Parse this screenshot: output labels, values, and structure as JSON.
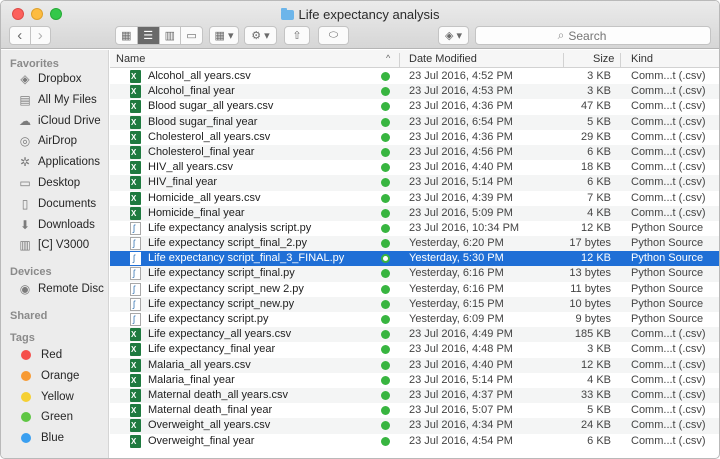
{
  "window": {
    "title": "Life expectancy analysis",
    "search_placeholder": "Search"
  },
  "toolbar": {
    "back_glyph": "‹",
    "forward_glyph": "›",
    "view_icon_glyph": "▦",
    "view_list_glyph": "☰",
    "view_column_glyph": "▥",
    "view_coverflow_glyph": "▭",
    "arrange_glyph": "▦ ▾",
    "action_glyph": "⚙ ▾",
    "share_glyph": "⇧",
    "tag_glyph": "⬭",
    "dropbox_glyph": "◈ ▾",
    "search_glyph": "⌕"
  },
  "sidebar": {
    "favorites_heading": "Favorites",
    "favorites": [
      {
        "label": "Dropbox",
        "icon": "dropbox-icon",
        "glyph": "◈"
      },
      {
        "label": "All My Files",
        "icon": "all-files-icon",
        "glyph": "▤"
      },
      {
        "label": "iCloud Drive",
        "icon": "cloud-icon",
        "glyph": "☁"
      },
      {
        "label": "AirDrop",
        "icon": "airdrop-icon",
        "glyph": "◎"
      },
      {
        "label": "Applications",
        "icon": "applications-icon",
        "glyph": "✲"
      },
      {
        "label": "Desktop",
        "icon": "desktop-icon",
        "glyph": "▭"
      },
      {
        "label": "Documents",
        "icon": "documents-icon",
        "glyph": "▯"
      },
      {
        "label": "Downloads",
        "icon": "downloads-icon",
        "glyph": "⬇"
      },
      {
        "label": "[C] V3000",
        "icon": "drive-icon",
        "glyph": "▥"
      }
    ],
    "devices_heading": "Devices",
    "devices": [
      {
        "label": "Remote Disc",
        "icon": "disc-icon",
        "glyph": "◉"
      }
    ],
    "shared_heading": "Shared",
    "tags_heading": "Tags",
    "tags": [
      {
        "label": "Red",
        "color": "#f54f4b"
      },
      {
        "label": "Orange",
        "color": "#f79a33"
      },
      {
        "label": "Yellow",
        "color": "#f5d033"
      },
      {
        "label": "Green",
        "color": "#5fc644"
      },
      {
        "label": "Blue",
        "color": "#3a9ff0"
      }
    ]
  },
  "columns": {
    "name": "Name",
    "sort_glyph": "^",
    "date": "Date Modified",
    "size": "Size",
    "kind": "Kind"
  },
  "files": [
    {
      "name": "Alcohol_all years.csv",
      "date": "23 Jul 2016, 4:52 PM",
      "size": "3 KB",
      "kind": "Comm...t (.csv)",
      "type": "csv"
    },
    {
      "name": "Alcohol_final year",
      "date": "23 Jul 2016, 4:53 PM",
      "size": "3 KB",
      "kind": "Comm...t (.csv)",
      "type": "csv"
    },
    {
      "name": "Blood sugar_all years.csv",
      "date": "23 Jul 2016, 4:36 PM",
      "size": "47 KB",
      "kind": "Comm...t (.csv)",
      "type": "csv"
    },
    {
      "name": "Blood sugar_final year",
      "date": "23 Jul 2016, 6:54 PM",
      "size": "5 KB",
      "kind": "Comm...t (.csv)",
      "type": "csv"
    },
    {
      "name": "Cholesterol_all years.csv",
      "date": "23 Jul 2016, 4:36 PM",
      "size": "29 KB",
      "kind": "Comm...t (.csv)",
      "type": "csv"
    },
    {
      "name": "Cholesterol_final year",
      "date": "23 Jul 2016, 4:56 PM",
      "size": "6 KB",
      "kind": "Comm...t (.csv)",
      "type": "csv"
    },
    {
      "name": "HIV_all years.csv",
      "date": "23 Jul 2016, 4:40 PM",
      "size": "18 KB",
      "kind": "Comm...t (.csv)",
      "type": "csv"
    },
    {
      "name": "HIV_final year",
      "date": "23 Jul 2016, 5:14 PM",
      "size": "6 KB",
      "kind": "Comm...t (.csv)",
      "type": "csv"
    },
    {
      "name": "Homicide_all years.csv",
      "date": "23 Jul 2016, 4:39 PM",
      "size": "7 KB",
      "kind": "Comm...t (.csv)",
      "type": "csv"
    },
    {
      "name": "Homicide_final year",
      "date": "23 Jul 2016, 5:09 PM",
      "size": "4 KB",
      "kind": "Comm...t (.csv)",
      "type": "csv"
    },
    {
      "name": "Life expectancy analysis script.py",
      "date": "23 Jul 2016, 10:34 PM",
      "size": "12 KB",
      "kind": "Python Source",
      "type": "py"
    },
    {
      "name": "Life expectancy script_final_2.py",
      "date": "Yesterday, 6:20 PM",
      "size": "17 bytes",
      "kind": "Python Source",
      "type": "py"
    },
    {
      "name": "Life expectancy script_final_3_FINAL.py",
      "date": "Yesterday, 5:30 PM",
      "size": "12 KB",
      "kind": "Python Source",
      "type": "py",
      "selected": true
    },
    {
      "name": "Life expectancy script_final.py",
      "date": "Yesterday, 6:16 PM",
      "size": "13 bytes",
      "kind": "Python Source",
      "type": "py"
    },
    {
      "name": "Life expectancy script_new 2.py",
      "date": "Yesterday, 6:16 PM",
      "size": "11 bytes",
      "kind": "Python Source",
      "type": "py"
    },
    {
      "name": "Life expectancy script_new.py",
      "date": "Yesterday, 6:15 PM",
      "size": "10 bytes",
      "kind": "Python Source",
      "type": "py"
    },
    {
      "name": "Life expectancy script.py",
      "date": "Yesterday, 6:09 PM",
      "size": "9 bytes",
      "kind": "Python Source",
      "type": "py"
    },
    {
      "name": "Life expectancy_all years.csv",
      "date": "23 Jul 2016, 4:49 PM",
      "size": "185 KB",
      "kind": "Comm...t (.csv)",
      "type": "csv"
    },
    {
      "name": "Life expectancy_final year",
      "date": "23 Jul 2016, 4:48 PM",
      "size": "3 KB",
      "kind": "Comm...t (.csv)",
      "type": "csv"
    },
    {
      "name": "Malaria_all years.csv",
      "date": "23 Jul 2016, 4:40 PM",
      "size": "12 KB",
      "kind": "Comm...t (.csv)",
      "type": "csv"
    },
    {
      "name": "Malaria_final year",
      "date": "23 Jul 2016, 5:14 PM",
      "size": "4 KB",
      "kind": "Comm...t (.csv)",
      "type": "csv"
    },
    {
      "name": "Maternal death_all years.csv",
      "date": "23 Jul 2016, 4:37 PM",
      "size": "33 KB",
      "kind": "Comm...t (.csv)",
      "type": "csv"
    },
    {
      "name": "Maternal death_final year",
      "date": "23 Jul 2016, 5:07 PM",
      "size": "5 KB",
      "kind": "Comm...t (.csv)",
      "type": "csv"
    },
    {
      "name": "Overweight_all years.csv",
      "date": "23 Jul 2016, 4:34 PM",
      "size": "24 KB",
      "kind": "Comm...t (.csv)",
      "type": "csv"
    },
    {
      "name": "Overweight_final year",
      "date": "23 Jul 2016, 4:54 PM",
      "size": "6 KB",
      "kind": "Comm...t (.csv)",
      "type": "csv"
    }
  ]
}
